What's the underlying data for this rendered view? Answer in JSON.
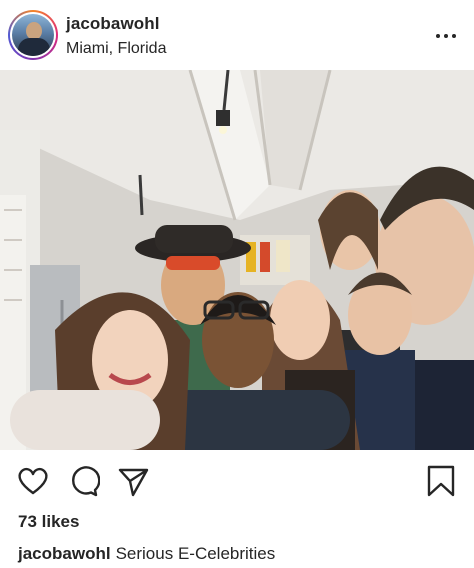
{
  "post": {
    "username": "jacobawohl",
    "location": "Miami, Florida"
  },
  "icons": {
    "more": "more-options-icon",
    "like": "heart-icon",
    "comment": "comment-bubble-icon",
    "share": "paper-plane-icon",
    "save": "bookmark-icon"
  },
  "engagement": {
    "likes_text": "73 likes"
  },
  "caption": {
    "username": "jacobawohl",
    "text": "Serious E-Celebrities"
  },
  "colors": {
    "text": "#262626",
    "background": "#ffffff"
  }
}
